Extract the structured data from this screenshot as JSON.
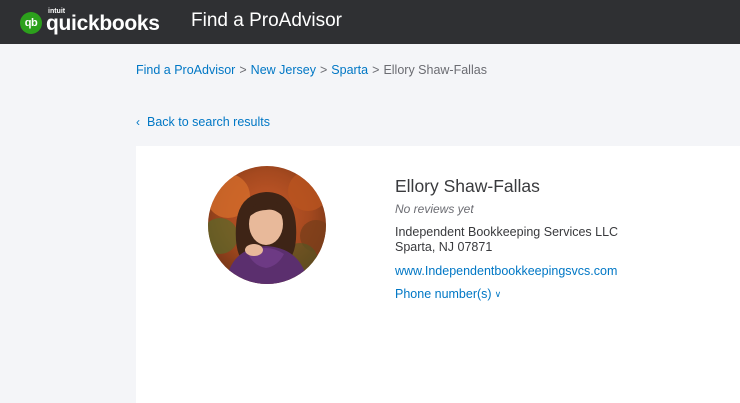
{
  "header": {
    "logo_intuit": "intuit",
    "logo_name": "quickbooks",
    "logo_mark": "qb",
    "app_title": "Find a ProAdvisor"
  },
  "breadcrumb": {
    "items": [
      "Find a ProAdvisor",
      "New Jersey",
      "Sparta"
    ],
    "current": "Ellory Shaw-Fallas",
    "separator": ">"
  },
  "back_link": {
    "label": "Back to search results",
    "icon": "chevron-left-icon"
  },
  "profile": {
    "name": "Ellory Shaw-Fallas",
    "reviews": "No reviews yet",
    "company": "Independent Bookkeeping Services LLC",
    "address": "Sparta, NJ 07871",
    "website": "www.Independentbookkeepingsvcs.com",
    "phone_label": "Phone number(s)"
  },
  "colors": {
    "header_bg": "#2f3033",
    "brand_green": "#2ca01c",
    "link_blue": "#0077c5",
    "page_bg": "#f4f5f8"
  }
}
